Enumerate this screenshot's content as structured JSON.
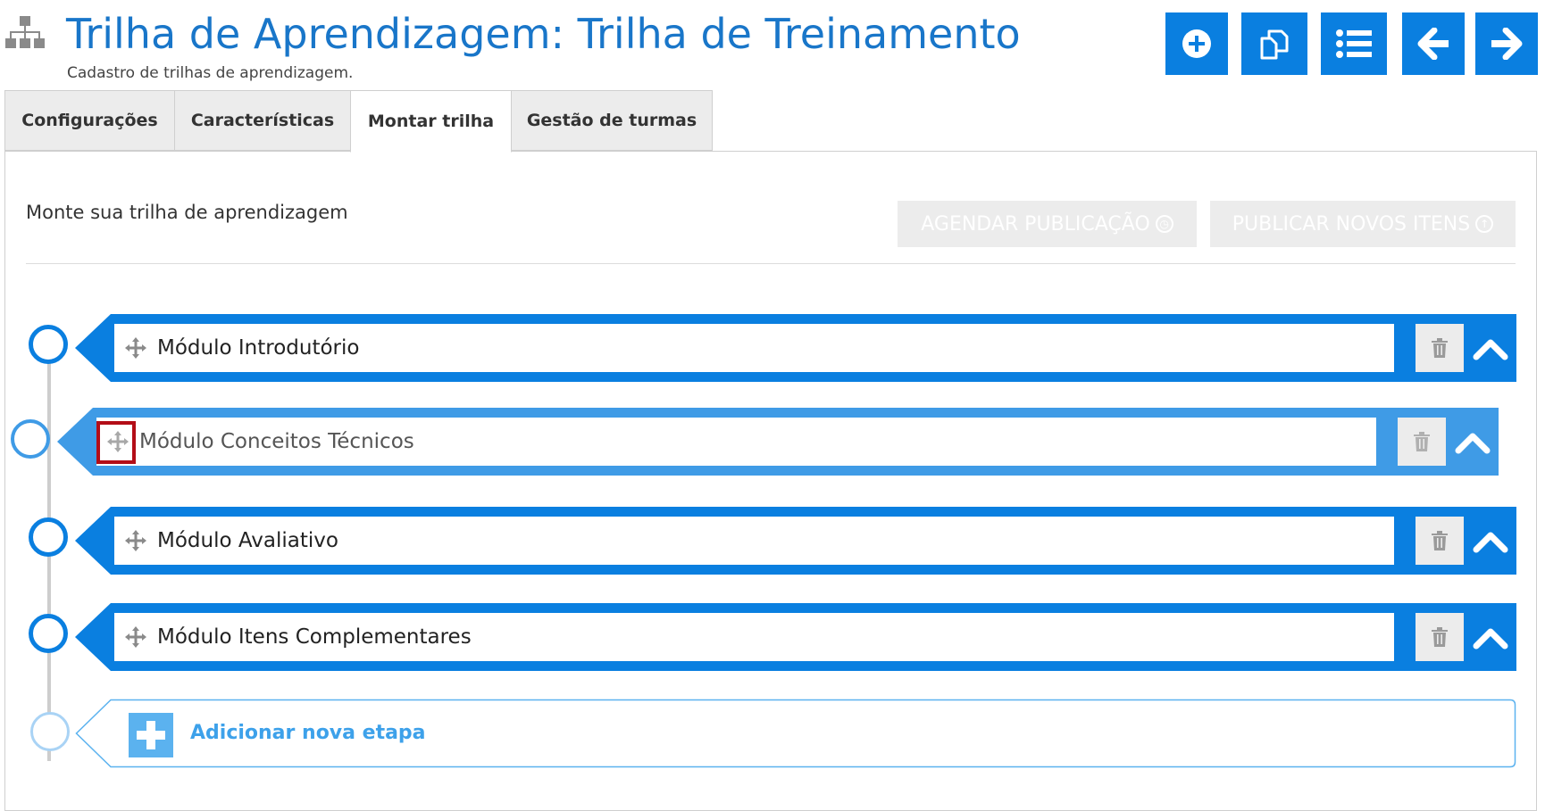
{
  "header": {
    "icon": "sitemap-icon",
    "title": "Trilha de Aprendizagem: Trilha de Treinamento",
    "subtitle": "Cadastro de trilhas de aprendizagem."
  },
  "toolbar": {
    "buttons": [
      {
        "name": "add-icon"
      },
      {
        "name": "copy-icon"
      },
      {
        "name": "list-icon"
      },
      {
        "name": "arrow-left-icon"
      },
      {
        "name": "arrow-right-icon"
      }
    ]
  },
  "tabs": [
    {
      "label": "Configurações"
    },
    {
      "label": "Características"
    },
    {
      "label": "Montar trilha",
      "active": true
    },
    {
      "label": "Gestão de turmas"
    }
  ],
  "panel": {
    "title": "Monte sua trilha de aprendizagem",
    "schedule_label": "AGENDAR PUBLICAÇÃO",
    "publish_label": "PUBLICAR NOVOS ITENS"
  },
  "modules": [
    {
      "label": "Módulo Introdutório"
    },
    {
      "label": "Módulo Conceitos Técnicos",
      "dragging": true
    },
    {
      "label": "Módulo Avaliativo"
    },
    {
      "label": "Módulo Itens Complementares"
    }
  ],
  "add_stage": {
    "label": "Adicionar nova etapa"
  },
  "colors": {
    "primary": "#0a7fe0",
    "dragging": "#3f9be6",
    "title": "#1976c9",
    "highlight": "#b30d17",
    "add_accent": "#5bb2ef"
  }
}
